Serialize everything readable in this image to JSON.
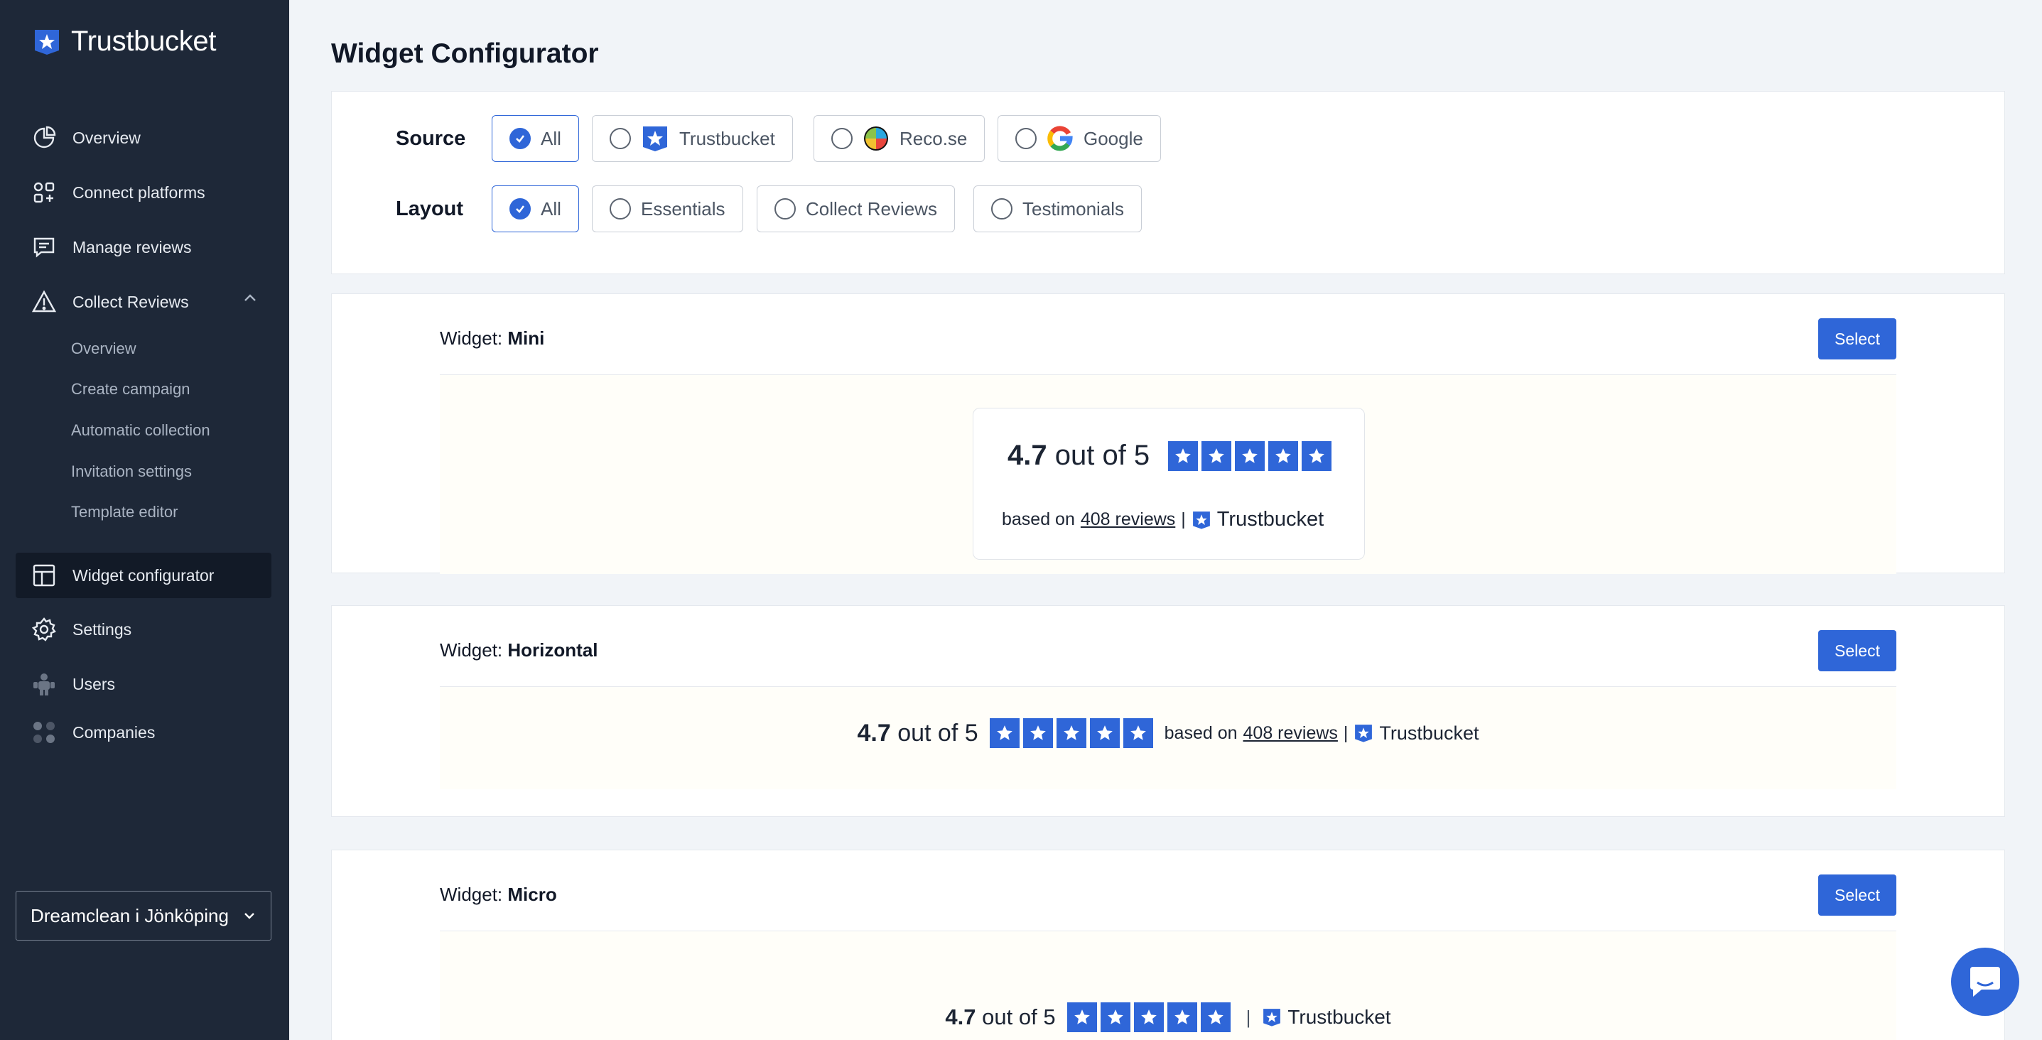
{
  "brand": {
    "name": "Trustbucket"
  },
  "sidebar": {
    "items": [
      {
        "label": "Overview",
        "icon": "pie-chart-icon"
      },
      {
        "label": "Connect platforms",
        "icon": "apps-grid-icon"
      },
      {
        "label": "Manage reviews",
        "icon": "message-icon"
      },
      {
        "label": "Collect Reviews",
        "icon": "triangle-alert-icon",
        "expanded": true
      },
      {
        "label": "Widget configurator",
        "icon": "layout-icon",
        "active": true
      },
      {
        "label": "Settings",
        "icon": "gear-icon"
      },
      {
        "label": "Users",
        "icon": "users-icon"
      },
      {
        "label": "Companies",
        "icon": "companies-icon"
      }
    ],
    "sub_items": [
      "Overview",
      "Create campaign",
      "Automatic collection",
      "Invitation settings",
      "Template editor"
    ],
    "company_select": "Dreamclean i Jönköping"
  },
  "page": {
    "title": "Widget Configurator"
  },
  "filters": {
    "source_label": "Source",
    "source_options": [
      "All",
      "Trustbucket",
      "Reco.se",
      "Google"
    ],
    "layout_label": "Layout",
    "layout_options": [
      "All",
      "Essentials",
      "Collect Reviews",
      "Testimonials"
    ]
  },
  "widgets": {
    "prefix": "Widget:",
    "select_label": "Select",
    "mini": {
      "name": "Mini"
    },
    "horizontal": {
      "name": "Horizontal"
    },
    "micro": {
      "name": "Micro"
    }
  },
  "rating": {
    "score": "4.7",
    "out_of": "out of 5",
    "stars": 5,
    "based_on": "based on",
    "reviews_link": "408 reviews",
    "separator": "|",
    "logo_text": "Trustbucket"
  },
  "colors": {
    "accent": "#2f66d8",
    "sidebar_bg": "#1e2838",
    "page_bg": "#f1f4f8"
  }
}
